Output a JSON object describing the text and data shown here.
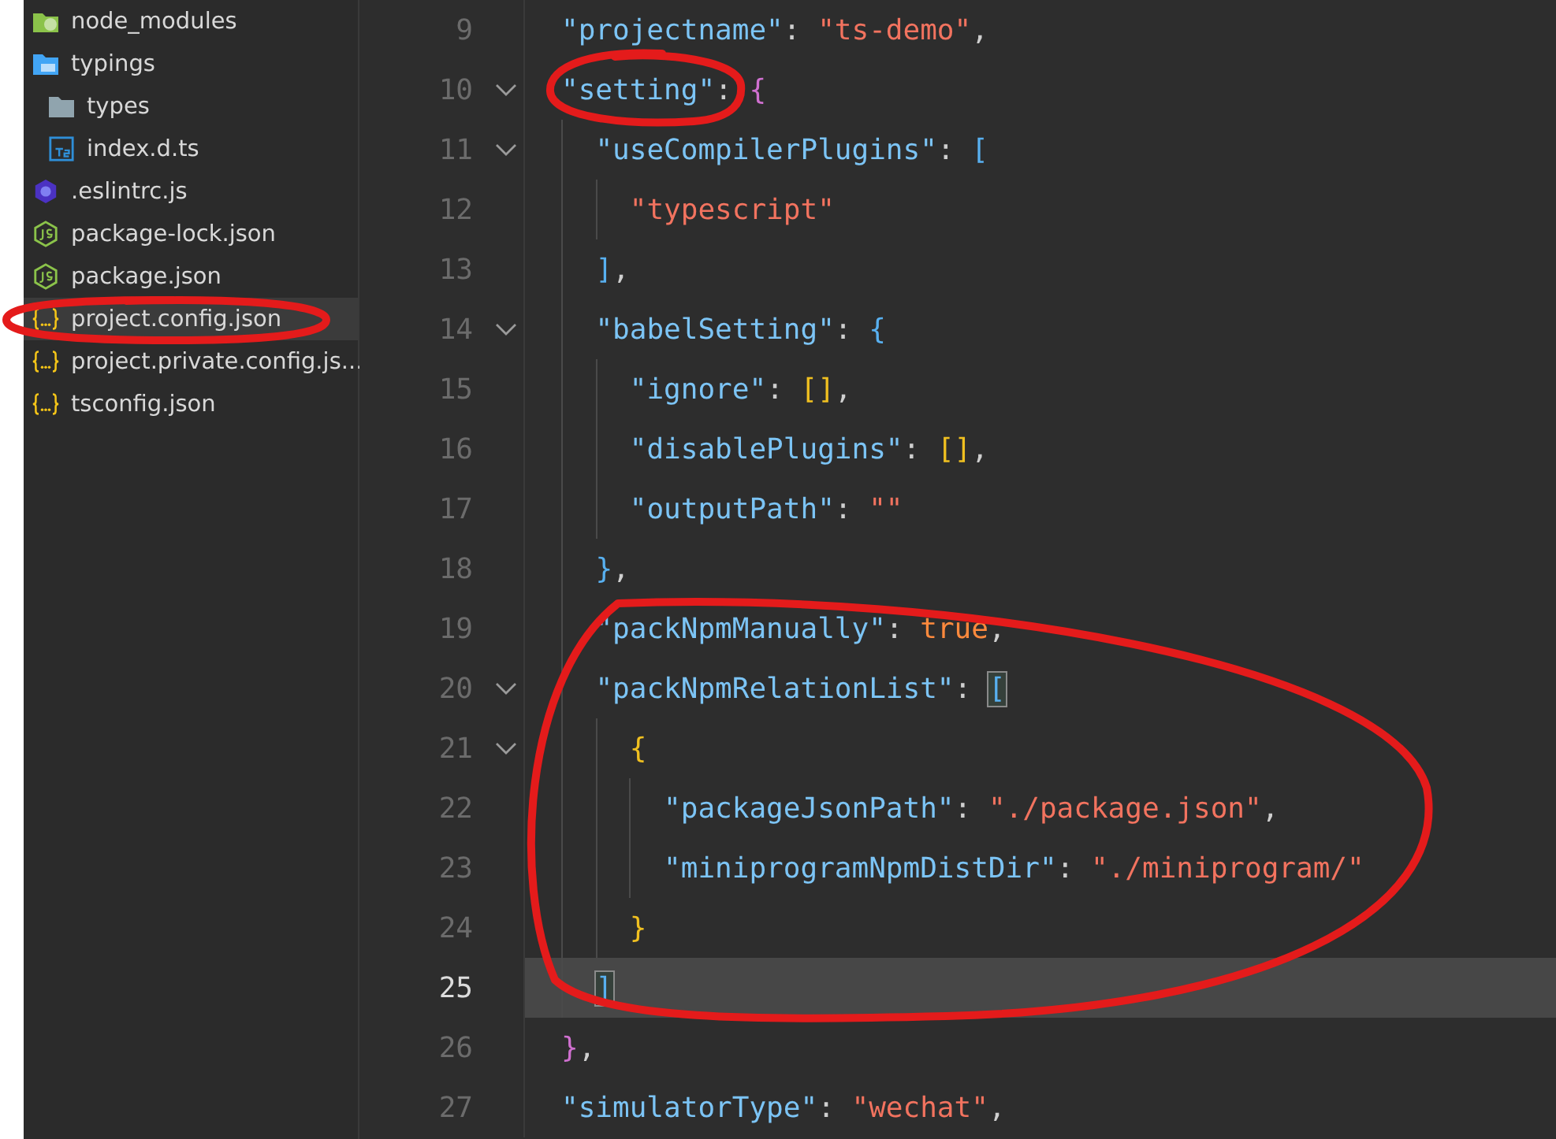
{
  "sidebar": {
    "items": [
      {
        "name": "node_modules",
        "kind": "modules",
        "selected": false
      },
      {
        "name": "typings",
        "kind": "tsfolder",
        "selected": false,
        "children": [
          {
            "name": "types",
            "kind": "folder",
            "selected": false
          },
          {
            "name": "index.d.ts",
            "kind": "typescript",
            "selected": false
          }
        ]
      },
      {
        "name": ".eslintrc.js",
        "kind": "eslint",
        "selected": false
      },
      {
        "name": "package-lock.json",
        "kind": "node",
        "selected": false
      },
      {
        "name": "package.json",
        "kind": "node",
        "selected": false
      },
      {
        "name": "project.config.json",
        "kind": "json",
        "selected": true
      },
      {
        "name": "project.private.config.js...",
        "kind": "json",
        "selected": false
      },
      {
        "name": "tsconfig.json",
        "kind": "json",
        "selected": false
      }
    ]
  },
  "editor": {
    "lines": [
      {
        "number": "9",
        "current": false,
        "foldable": false,
        "tokens": [
          {
            "kind": "key",
            "text": "\"projectname\""
          },
          {
            "kind": "punct",
            "text": ": "
          },
          {
            "kind": "string",
            "text": "\"ts-demo\""
          },
          {
            "kind": "punct",
            "text": ","
          }
        ]
      },
      {
        "number": "10",
        "current": false,
        "foldable": true,
        "tokens": [
          {
            "kind": "key",
            "text": "\"setting\""
          },
          {
            "kind": "punct",
            "text": ": "
          },
          {
            "kind": "brace2",
            "text": "{",
            "match": false
          }
        ]
      },
      {
        "number": "11",
        "current": false,
        "foldable": true,
        "tokens": [
          {
            "kind": "key",
            "text": "  \"useCompilerPlugins\""
          },
          {
            "kind": "punct",
            "text": ": "
          },
          {
            "kind": "brace3",
            "text": "[",
            "match": false
          }
        ]
      },
      {
        "number": "12",
        "current": false,
        "foldable": false,
        "tokens": [
          {
            "kind": "string",
            "text": "    \"typescript\""
          }
        ]
      },
      {
        "number": "13",
        "current": false,
        "foldable": false,
        "tokens": [
          {
            "kind": "brace3",
            "text": "  ]",
            "match": false
          },
          {
            "kind": "punct",
            "text": ","
          }
        ]
      },
      {
        "number": "14",
        "current": false,
        "foldable": true,
        "tokens": [
          {
            "kind": "key",
            "text": "  \"babelSetting\""
          },
          {
            "kind": "punct",
            "text": ": "
          },
          {
            "kind": "brace3",
            "text": "{",
            "match": false
          }
        ]
      },
      {
        "number": "15",
        "current": false,
        "foldable": false,
        "tokens": [
          {
            "kind": "key",
            "text": "    \"ignore\""
          },
          {
            "kind": "punct",
            "text": ": "
          },
          {
            "kind": "brace1",
            "text": "[]",
            "match": false
          },
          {
            "kind": "punct",
            "text": ","
          }
        ]
      },
      {
        "number": "16",
        "current": false,
        "foldable": false,
        "tokens": [
          {
            "kind": "key",
            "text": "    \"disablePlugins\""
          },
          {
            "kind": "punct",
            "text": ": "
          },
          {
            "kind": "brace1",
            "text": "[]",
            "match": false
          },
          {
            "kind": "punct",
            "text": ","
          }
        ]
      },
      {
        "number": "17",
        "current": false,
        "foldable": false,
        "tokens": [
          {
            "kind": "key",
            "text": "    \"outputPath\""
          },
          {
            "kind": "punct",
            "text": ": "
          },
          {
            "kind": "string",
            "text": "\"\""
          }
        ]
      },
      {
        "number": "18",
        "current": false,
        "foldable": false,
        "tokens": [
          {
            "kind": "brace3",
            "text": "  }",
            "match": false
          },
          {
            "kind": "punct",
            "text": ","
          }
        ]
      },
      {
        "number": "19",
        "current": false,
        "foldable": false,
        "tokens": [
          {
            "kind": "key",
            "text": "  \"packNpmManually\""
          },
          {
            "kind": "punct",
            "text": ": "
          },
          {
            "kind": "literal",
            "text": "true"
          },
          {
            "kind": "punct",
            "text": ","
          }
        ]
      },
      {
        "number": "20",
        "current": false,
        "foldable": true,
        "tokens": [
          {
            "kind": "key",
            "text": "  \"packNpmRelationList\""
          },
          {
            "kind": "punct",
            "text": ": "
          },
          {
            "kind": "brace3",
            "text": "[",
            "match": true
          }
        ]
      },
      {
        "number": "21",
        "current": false,
        "foldable": true,
        "tokens": [
          {
            "kind": "brace1",
            "text": "    {",
            "match": false
          }
        ]
      },
      {
        "number": "22",
        "current": false,
        "foldable": false,
        "tokens": [
          {
            "kind": "key",
            "text": "      \"packageJsonPath\""
          },
          {
            "kind": "punct",
            "text": ": "
          },
          {
            "kind": "string",
            "text": "\"./package.json\""
          },
          {
            "kind": "punct",
            "text": ","
          }
        ]
      },
      {
        "number": "23",
        "current": false,
        "foldable": false,
        "tokens": [
          {
            "kind": "key",
            "text": "      \"miniprogramNpmDistDir\""
          },
          {
            "kind": "punct",
            "text": ": "
          },
          {
            "kind": "string",
            "text": "\"./miniprogram/\""
          }
        ]
      },
      {
        "number": "24",
        "current": false,
        "foldable": false,
        "tokens": [
          {
            "kind": "brace1",
            "text": "    }",
            "match": false
          }
        ]
      },
      {
        "number": "25",
        "current": true,
        "foldable": false,
        "tokens": [
          {
            "kind": "brace3",
            "text": "  ]",
            "match": true
          }
        ]
      },
      {
        "number": "26",
        "current": false,
        "foldable": false,
        "tokens": [
          {
            "kind": "brace2",
            "text": "}",
            "match": false
          },
          {
            "kind": "punct",
            "text": ","
          }
        ]
      },
      {
        "number": "27",
        "current": false,
        "foldable": false,
        "tokens": [
          {
            "kind": "key",
            "text": "\"simulatorType\""
          },
          {
            "kind": "punct",
            "text": ": "
          },
          {
            "kind": "string",
            "text": "\"wechat\""
          },
          {
            "kind": "punct",
            "text": ","
          }
        ]
      }
    ]
  }
}
